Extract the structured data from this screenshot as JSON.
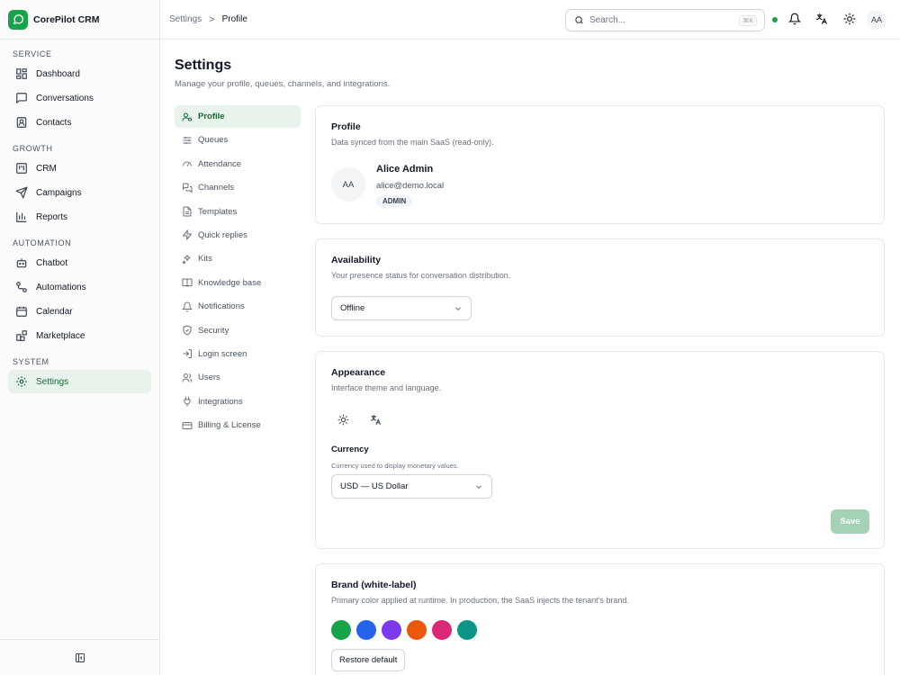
{
  "app": {
    "name": "CorePilot CRM",
    "logo_icon": "chat-bubble-icon",
    "brand_color": "#16a34a"
  },
  "sidebar": {
    "groups": [
      {
        "title": "SERVICE",
        "items": [
          {
            "label": "Dashboard",
            "icon": "grid-icon"
          },
          {
            "label": "Conversations",
            "icon": "message-square-icon"
          },
          {
            "label": "Contacts",
            "icon": "contact-card-icon"
          }
        ]
      },
      {
        "title": "GROWTH",
        "items": [
          {
            "label": "CRM",
            "icon": "kanban-icon"
          },
          {
            "label": "Campaigns",
            "icon": "send-icon"
          },
          {
            "label": "Reports",
            "icon": "bar-chart-icon"
          }
        ]
      },
      {
        "title": "AUTOMATION",
        "items": [
          {
            "label": "Chatbot",
            "icon": "bot-icon"
          },
          {
            "label": "Automations",
            "icon": "workflow-icon"
          },
          {
            "label": "Calendar",
            "icon": "calendar-icon"
          },
          {
            "label": "Marketplace",
            "icon": "blocks-icon"
          }
        ]
      },
      {
        "title": "SYSTEM",
        "items": [
          {
            "label": "Settings",
            "icon": "gear-icon",
            "active": true
          }
        ]
      }
    ],
    "collapse_icon": "panel-collapse-icon"
  },
  "topbar": {
    "breadcrumb": {
      "root": "Settings",
      "separator": ">",
      "current": "Profile"
    },
    "search": {
      "placeholder": "Search...",
      "shortcut": "⌘K"
    },
    "status_color": "#16a34a",
    "avatar_initials": "AA"
  },
  "page": {
    "title": "Settings",
    "subtitle": "Manage your profile, queues, channels, and integrations."
  },
  "subnav": [
    {
      "label": "Profile",
      "icon": "user-cog-icon",
      "active": true
    },
    {
      "label": "Queues",
      "icon": "sliders-icon"
    },
    {
      "label": "Attendance",
      "icon": "gauge-icon"
    },
    {
      "label": "Channels",
      "icon": "messages-icon"
    },
    {
      "label": "Templates",
      "icon": "file-text-icon"
    },
    {
      "label": "Quick replies",
      "icon": "zap-icon"
    },
    {
      "label": "Kits",
      "icon": "sparkles-icon"
    },
    {
      "label": "Knowledge base",
      "icon": "book-open-icon"
    },
    {
      "label": "Notifications",
      "icon": "bell-icon"
    },
    {
      "label": "Security",
      "icon": "shield-check-icon"
    },
    {
      "label": "Login screen",
      "icon": "log-in-icon"
    },
    {
      "label": "Users",
      "icon": "users-icon"
    },
    {
      "label": "Integrations",
      "icon": "plug-icon"
    },
    {
      "label": "Billing & License",
      "icon": "credit-card-icon"
    }
  ],
  "profile": {
    "title": "Profile",
    "description": "Data synced from the main SaaS (read-only).",
    "initials": "AA",
    "name": "Alice Admin",
    "email": "alice@demo.local",
    "role": "ADMIN"
  },
  "availability": {
    "title": "Availability",
    "description": "Your presence status for conversation distribution.",
    "status": "Offline"
  },
  "appearance": {
    "title": "Appearance",
    "description": "Interface theme and language.",
    "theme_icon": "sun-icon",
    "language_icon": "translate-icon",
    "currency_label": "Currency",
    "currency_hint": "Currency used to display monetary values.",
    "currency_value": "USD — US Dollar",
    "save_label": "Save"
  },
  "brand": {
    "title": "Brand (white-label)",
    "description": "Primary color applied at runtime. In production, the SaaS injects the tenant's brand.",
    "swatches": [
      "#16a34a",
      "#2563eb",
      "#7c3aed",
      "#ea580c",
      "#db2777",
      "#0d9488"
    ],
    "restore_label": "Restore default"
  }
}
